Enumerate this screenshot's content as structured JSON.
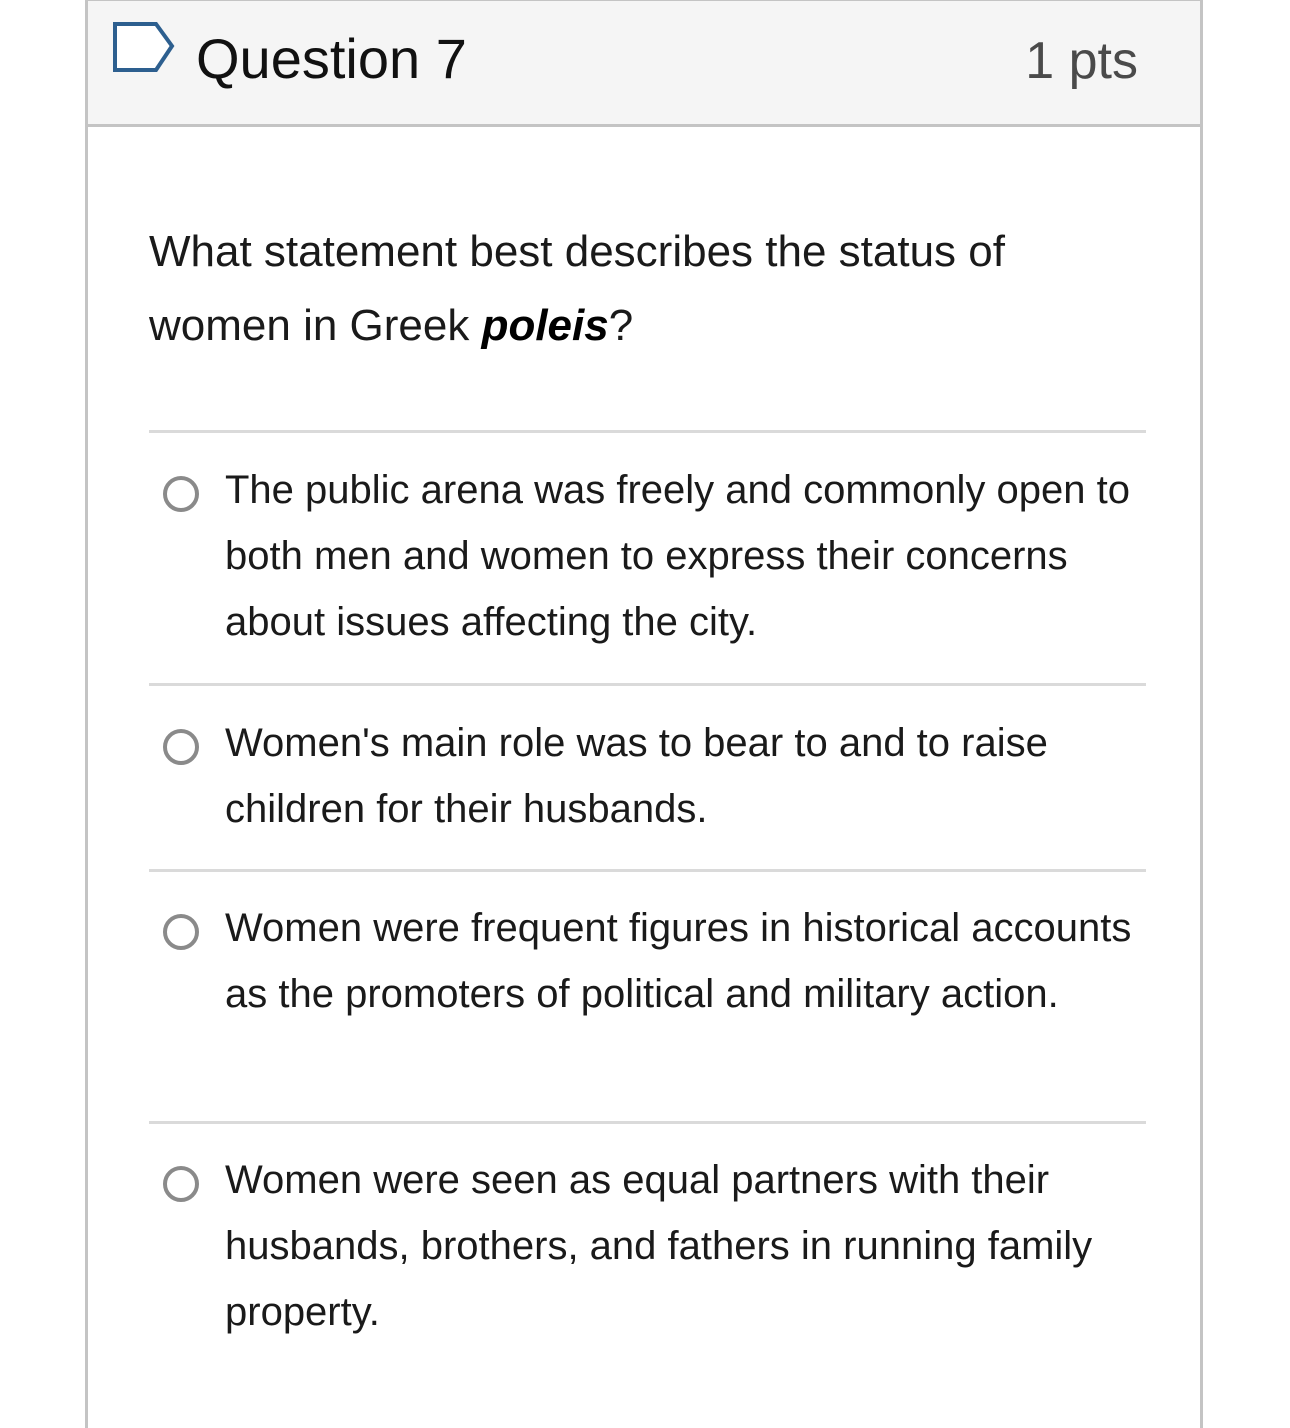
{
  "question": {
    "title": "Question 7",
    "points": "1 pts",
    "prompt_before": "What statement best describes the status of women in Greek ",
    "prompt_emphasis": "poleis",
    "prompt_after": "?"
  },
  "answers": [
    {
      "label": "The public arena was freely and commonly open to both men and women to express their concerns about issues affecting the city.",
      "selected": false
    },
    {
      "label": "Women's main role was to bear to and to raise children for their husbands.",
      "selected": false
    },
    {
      "label": "Women were frequent figures in historical accounts as the promoters of political and military action.",
      "selected": false
    },
    {
      "label": "Women were seen as equal partners with their husbands, brothers, and fathers in running family property.",
      "selected": false
    }
  ],
  "colors": {
    "border": "#c4c4c4",
    "header_bg": "#f5f5f5",
    "flag_outline": "#2d5f8f",
    "radio_border": "#8a8a8a"
  },
  "icons": {
    "flag": "flag-question-icon",
    "radio": "radio-unchecked-icon"
  }
}
